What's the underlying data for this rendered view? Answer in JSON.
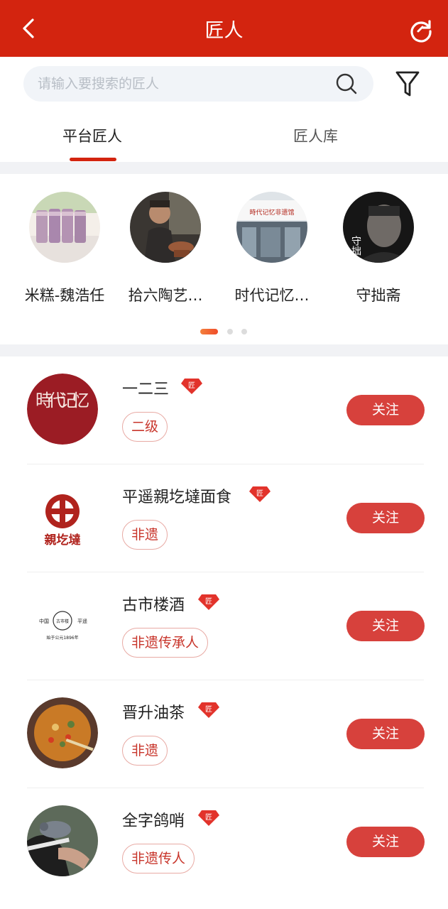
{
  "header": {
    "title": "匠人"
  },
  "search": {
    "placeholder": "请输入要搜索的匠人"
  },
  "tabs": [
    {
      "label": "平台匠人",
      "active": true
    },
    {
      "label": "匠人库",
      "active": false
    }
  ],
  "carousel": {
    "items": [
      {
        "name": "米糕-魏浩任"
      },
      {
        "name": "拾六陶艺…"
      },
      {
        "name": "时代记忆…",
        "sign_text": "時代记忆非遗馆"
      },
      {
        "name": "守拙斋",
        "overlay_text": "守拙"
      }
    ],
    "page_count": 3,
    "active_page": 0
  },
  "list": {
    "follow_label": "关注",
    "badge_char": "匠",
    "items": [
      {
        "name": "一二三",
        "tag": "二级",
        "logo_text": "時代记忆"
      },
      {
        "name": "平遥親圪墶面食",
        "tag": "非遗",
        "logo_text": "親圪墶"
      },
      {
        "name": "古市楼酒",
        "tag": "非遗传承人",
        "logo_text": [
          "中国",
          "古市楼",
          "平遥",
          "始于公元1896年"
        ]
      },
      {
        "name": "晋升油茶",
        "tag": "非遗"
      },
      {
        "name": "全字鸽哨",
        "tag": "非遗传人"
      }
    ]
  },
  "colors": {
    "brand_red": "#d3240f",
    "follow_button": "#d7413c",
    "tag_text": "#c8352b"
  }
}
